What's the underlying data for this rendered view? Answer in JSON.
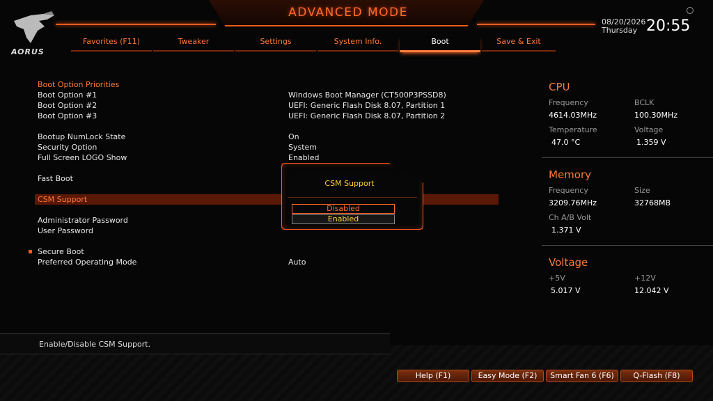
{
  "header": {
    "mode_title": "ADVANCED MODE",
    "date": "08/20/2026",
    "day": "Thursday",
    "time": "20:55",
    "brand": "AORUS"
  },
  "tabs": [
    {
      "label": "Favorites (F11)"
    },
    {
      "label": "Tweaker"
    },
    {
      "label": "Settings"
    },
    {
      "label": "System Info."
    },
    {
      "label": "Boot",
      "active": true
    },
    {
      "label": "Save & Exit"
    }
  ],
  "boot": {
    "priorities_title": "Boot Option Priorities",
    "option1": {
      "label": "Boot Option #1",
      "value": "Windows Boot Manager (CT500P3PSSD8)"
    },
    "option2": {
      "label": "Boot Option #2",
      "value": "UEFI: Generic Flash Disk 8.07, Partition 1"
    },
    "option3": {
      "label": "Boot Option #3",
      "value": "UEFI: Generic Flash Disk 8.07, Partition 2"
    },
    "numlock": {
      "label": "Bootup NumLock State",
      "value": "On"
    },
    "security": {
      "label": "Security Option",
      "value": "System"
    },
    "logo": {
      "label": "Full Screen LOGO Show",
      "value": "Enabled"
    },
    "fastboot": {
      "label": "Fast Boot"
    },
    "csm": {
      "label": "CSM Support"
    },
    "admin_pw": {
      "label": "Administrator Password"
    },
    "user_pw": {
      "label": "User Password"
    },
    "secure_boot": {
      "label": "Secure Boot"
    },
    "pref_mode": {
      "label": "Preferred Operating Mode",
      "value": "Auto"
    }
  },
  "popup": {
    "title": "CSM Support",
    "options": [
      "Disabled",
      "Enabled"
    ]
  },
  "help_text": "Enable/Disable CSM Support.",
  "cpu": {
    "title": "CPU",
    "frequency_label": "Frequency",
    "frequency": "4614.03MHz",
    "bclk_label": "BCLK",
    "bclk": "100.30MHz",
    "temp_label": "Temperature",
    "temp": "47.0 °C",
    "voltage_label": "Voltage",
    "voltage": "1.359 V"
  },
  "memory": {
    "title": "Memory",
    "frequency_label": "Frequency",
    "frequency": "3209.76MHz",
    "size_label": "Size",
    "size": "32768MB",
    "chab_label": "Ch A/B Volt",
    "chab": "1.371 V"
  },
  "voltage": {
    "title": "Voltage",
    "p5_label": "+5V",
    "p5": "5.017 V",
    "p12_label": "+12V",
    "p12": "12.042 V"
  },
  "buttons": {
    "help": "Help (F1)",
    "easy": "Easy Mode (F2)",
    "fan": "Smart Fan 6 (F6)",
    "qflash": "Q-Flash (F8)"
  },
  "colors": {
    "accent": "#ff5a1c",
    "highlight": "#5a1806",
    "popup_title": "#ffcc33"
  }
}
